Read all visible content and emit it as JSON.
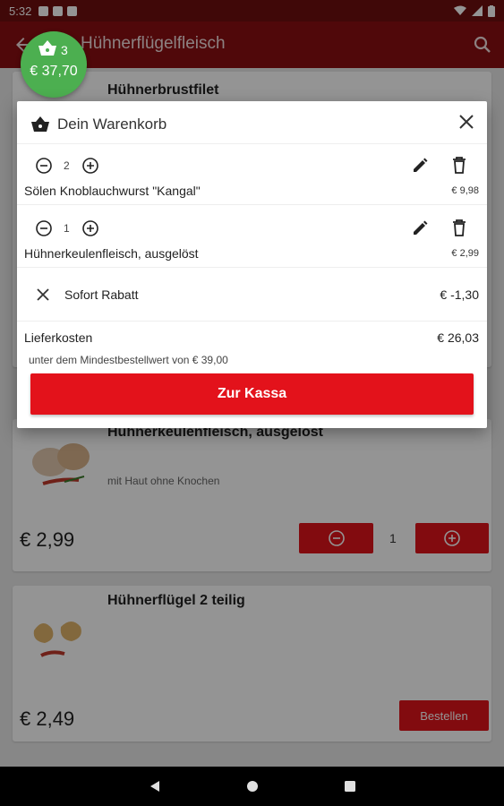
{
  "status_bar": {
    "time": "5:32"
  },
  "app_bar": {
    "title": "Hühnerflügelfleisch"
  },
  "cart_fab": {
    "count": "3",
    "total": "€ 37,70"
  },
  "products": [
    {
      "name": "Hühnerbrustfilet"
    },
    {
      "name": "Hühnerkeulenfleisch, ausgelöst",
      "description": "mit Haut ohne Knochen",
      "price": "€ 2,99",
      "quantity": "1"
    },
    {
      "name": "Hühnerflügel 2 teilig",
      "price": "€ 2,49",
      "order_label": "Bestellen"
    }
  ],
  "dialog": {
    "title": "Dein Warenkorb",
    "items": [
      {
        "quantity": "2",
        "name": "Sölen Knoblauchwurst \"Kangal\"",
        "price": "€ 9,98"
      },
      {
        "quantity": "1",
        "name": "Hühnerkeulenfleisch, ausgelöst",
        "price": "€ 2,99"
      }
    ],
    "discount": {
      "label": "Sofort Rabatt",
      "value": "€ -1,30"
    },
    "delivery": {
      "label": "Lieferkosten",
      "value": "€ 26,03"
    },
    "minimum_note": "unter dem Mindestbestellwert von € 39,00",
    "checkout_label": "Zur Kassa"
  },
  "colors": {
    "primary": "#8a0f12",
    "accent_red": "#e3121b",
    "fab_green": "#4caf50"
  }
}
